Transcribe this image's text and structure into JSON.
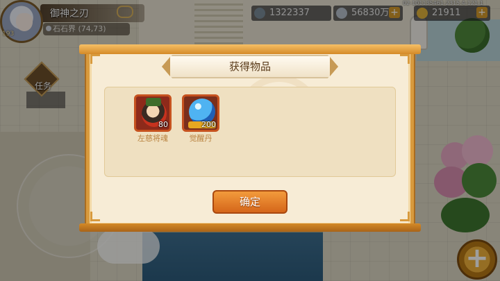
{
  "hud": {
    "player_name": "御神之刃",
    "level": "193",
    "location": "石石界",
    "coords": "(74,73)",
    "power": "1322337",
    "silver": "56830万",
    "gold": "21911",
    "version": "02-101135461-2315.4-121-1",
    "task_label": "任务",
    "plus_symbol": "+"
  },
  "dialog": {
    "title": "获得物品",
    "items": [
      {
        "name": "左慈将魂",
        "quantity": "80",
        "icon": "general-soul-icon"
      },
      {
        "name": "觉醒丹",
        "quantity": "200",
        "icon": "awakening-pill-icon"
      }
    ],
    "confirm_label": "确定"
  },
  "colors": {
    "dialog_border": "#d89a3d",
    "dialog_bg": "#f7ecd6",
    "confirm_button": "#e6802a",
    "item_frame": "#c6521f"
  }
}
